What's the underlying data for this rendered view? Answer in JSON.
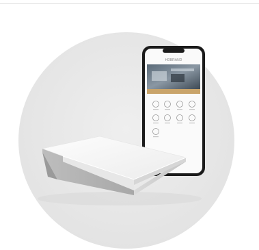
{
  "product_image": {
    "background_circle_color": "#e9e9e9",
    "hub_top_color": "#f5f5f5",
    "hub_side_color": "#cfcfcf",
    "phone_frame_color": "#1b1b1b",
    "phone_accent_color": "#c9a46a"
  },
  "phone_screen": {
    "brand_text": "HDBRAND",
    "icons": [
      "light-icon",
      "curtain-icon",
      "climate-icon",
      "camera-icon",
      "security-icon",
      "music-icon",
      "scene-icon",
      "energy-icon",
      "settings-icon"
    ]
  }
}
